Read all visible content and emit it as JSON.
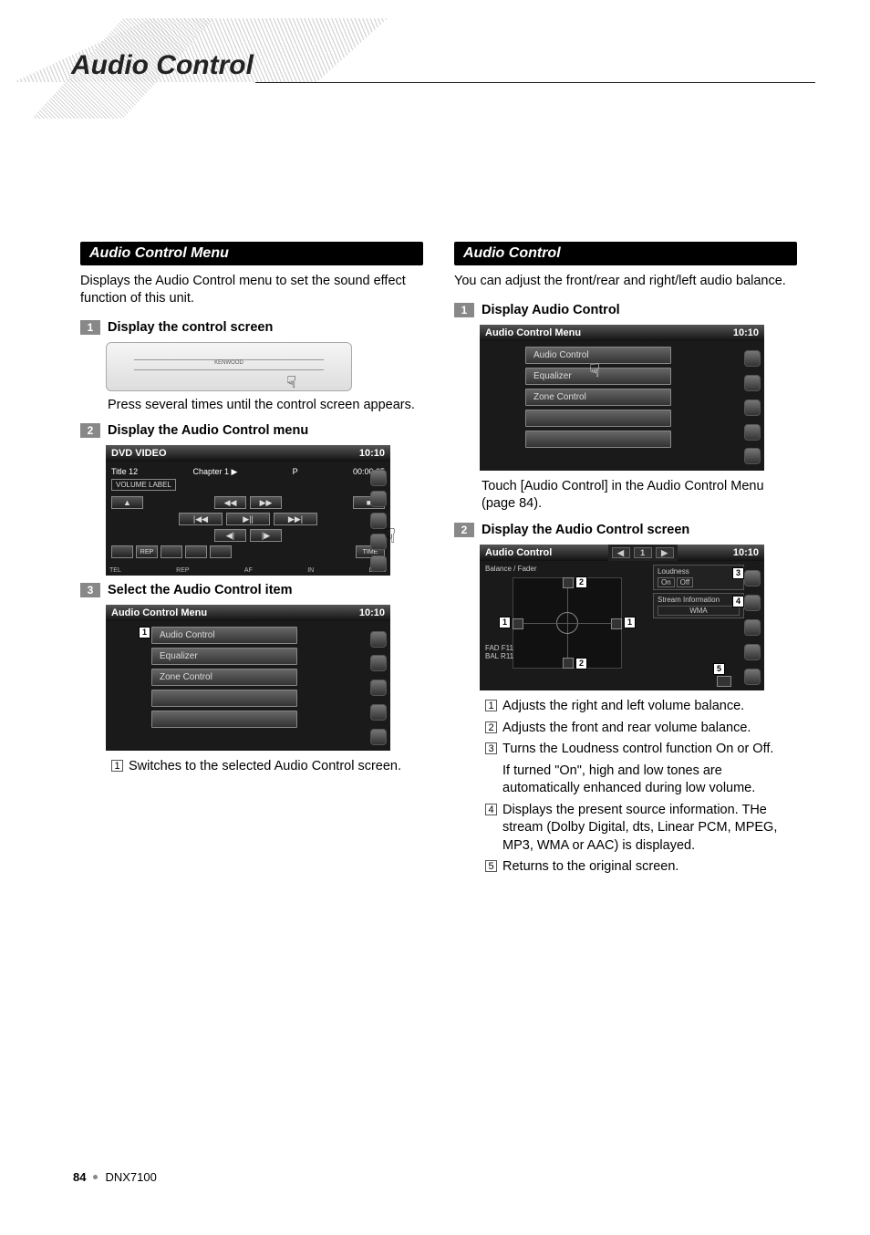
{
  "page_title": "Audio Control",
  "footer": {
    "page": "84",
    "model": "DNX7100"
  },
  "left": {
    "section_title": "Audio Control Menu",
    "intro": "Displays the Audio Control menu to set the sound effect function of this unit.",
    "steps": {
      "s1": {
        "num": "1",
        "title": "Display the control screen"
      },
      "s1_text": "Press several times until the control screen appears.",
      "s2": {
        "num": "2",
        "title": "Display the Audio Control menu"
      },
      "s3": {
        "num": "3",
        "title": "Select the Audio Control item"
      }
    },
    "faceplate_label": "KENWOOD",
    "dvd": {
      "title": "DVD VIDEO",
      "time": "10:10",
      "subtitle_left": "Title 12",
      "subtitle_mid": "Chapter   1   ▶",
      "subtitle_p": "P",
      "subtitle_time": "00:00:05",
      "vol": "VOLUME LABEL",
      "foot": [
        "TEL",
        "REP",
        "AF",
        "IN",
        "LOUD"
      ],
      "btns_row1": [
        "▲",
        "◀◀",
        "▶▶",
        "■"
      ],
      "btns_row2": [
        "|◀◀",
        "▶||",
        "▶▶|"
      ],
      "btns_row3": [
        "◀|",
        "|▶"
      ],
      "time_btn": "TIME",
      "rep_btn": "REP"
    },
    "menu3": {
      "title": "Audio Control Menu",
      "time": "10:10",
      "items": [
        "Audio Control",
        "Equalizer",
        "Zone Control"
      ],
      "callout": "1"
    },
    "callouts": {
      "c1": {
        "num": "1",
        "text": "Switches to the selected Audio Control screen."
      }
    }
  },
  "right": {
    "section_title": "Audio Control",
    "intro": "You can adjust the front/rear and right/left audio balance.",
    "steps": {
      "s1": {
        "num": "1",
        "title": "Display Audio Control"
      },
      "s1_text": "Touch [Audio Control] in the Audio Control Menu (page 84).",
      "s2": {
        "num": "2",
        "title": "Display the Audio Control screen"
      }
    },
    "menu1": {
      "title": "Audio Control Menu",
      "time": "10:10",
      "items": [
        "Audio Control",
        "Equalizer",
        "Zone Control"
      ]
    },
    "ac": {
      "title": "Audio Control",
      "time": "10:10",
      "balance_label": "Balance / Fader",
      "fad": "FAD F11",
      "bal": "BAL R11",
      "loudness": "Loudness",
      "loud_on": "On",
      "loud_off": "Off",
      "stream_lbl": "Stream Information",
      "stream_val": "WMA"
    },
    "callouts": {
      "c1": {
        "num": "1",
        "text": "Adjusts the right and left volume balance."
      },
      "c2": {
        "num": "2",
        "text": "Adjusts the front and rear volume balance."
      },
      "c3": {
        "num": "3",
        "text": "Turns the Loudness control function On or Off."
      },
      "c3b": "If turned \"On\", high and low tones are automatically enhanced during low volume.",
      "c4": {
        "num": "4",
        "text": "Displays the present source information. THe stream (Dolby Digital, dts, Linear PCM, MPEG, MP3, WMA or AAC) is displayed."
      },
      "c5": {
        "num": "5",
        "text": "Returns to the original screen."
      }
    }
  }
}
